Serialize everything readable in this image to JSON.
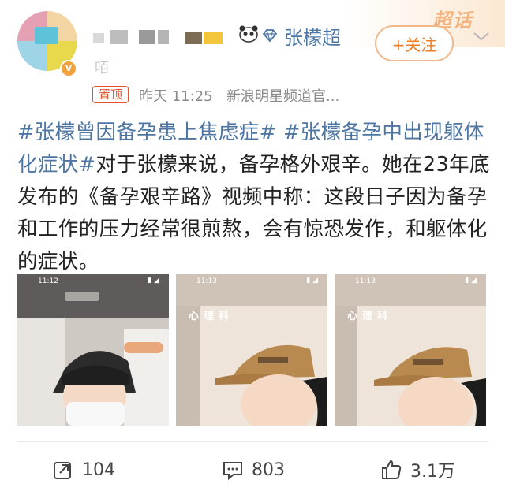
{
  "header": {
    "username": "张檬超",
    "name_tail": "咟",
    "follow_label": "+关注",
    "pinned_label": "置顶",
    "time": "昨天 11:25",
    "source": "新浪明星频道官...",
    "badge_text": "超话"
  },
  "post": {
    "tag1": "#张檬曾因备孕患上焦虑症#",
    "tag2": "#张檬备孕中出现躯体化症状#",
    "body": "对于张檬来说，备孕格外艰辛。她在23年底发布的《备孕艰辛路》视频中称：这段日子因为备孕和工作的压力经常很煎熬，会有惊恐发作，和躯体化的症状。"
  },
  "images": [
    {
      "time": "11:12",
      "caption": ""
    },
    {
      "time": "11:13",
      "caption": "心理科"
    },
    {
      "time": "11:13",
      "caption": "心理科"
    }
  ],
  "actions": {
    "repost_count": "104",
    "comment_count": "803",
    "like_count": "3.1万"
  },
  "colors": {
    "link": "#4e76a3",
    "accent": "#ee7d26",
    "pinned": "#e2522c"
  }
}
